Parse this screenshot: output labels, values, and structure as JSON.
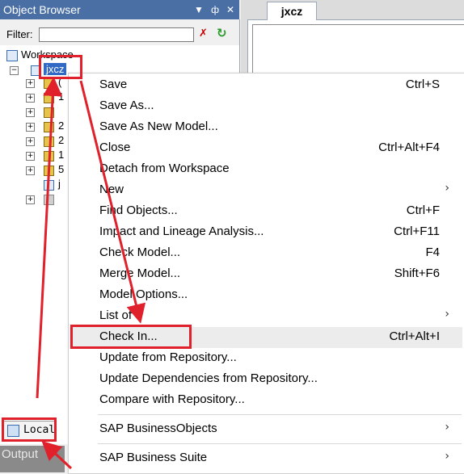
{
  "object_browser": {
    "title": "Object Browser",
    "pin_glyph": "▼",
    "dock_glyph": "ф",
    "close_glyph": "✕",
    "filter_label": "Filter:",
    "filter_value": "",
    "workspace_label": "Workspace",
    "model_label": "jxcz",
    "child_fragments": [
      "(",
      "1",
      "",
      "2",
      "2",
      "1",
      "5",
      "j",
      ""
    ],
    "local_tab_label": "Local",
    "output_label": "Output"
  },
  "document": {
    "tab_label": "jxcz"
  },
  "context_menu": {
    "items": [
      {
        "label": "Save",
        "shortcut": "Ctrl+S",
        "submenu": false
      },
      {
        "label": "Save As...",
        "shortcut": "",
        "submenu": false
      },
      {
        "label": "Save As New Model...",
        "shortcut": "",
        "submenu": false
      },
      {
        "label": "Close",
        "shortcut": "Ctrl+Alt+F4",
        "submenu": false
      },
      {
        "label": "Detach from Workspace",
        "shortcut": "",
        "submenu": false
      },
      {
        "label": "New",
        "shortcut": "",
        "submenu": true
      },
      {
        "label": "Find Objects...",
        "shortcut": "Ctrl+F",
        "submenu": false
      },
      {
        "label": "Impact and Lineage Analysis...",
        "shortcut": "Ctrl+F11",
        "submenu": false
      },
      {
        "label": "Check Model...",
        "shortcut": "F4",
        "submenu": false
      },
      {
        "label": "Merge Model...",
        "shortcut": "Shift+F6",
        "submenu": false
      },
      {
        "label": "Model Options...",
        "shortcut": "",
        "submenu": false
      },
      {
        "label": "List of",
        "shortcut": "",
        "submenu": true
      },
      {
        "label": "Check In...",
        "shortcut": "Ctrl+Alt+I",
        "submenu": false
      },
      {
        "label": "Update from Repository...",
        "shortcut": "",
        "submenu": false
      },
      {
        "label": "Update Dependencies from Repository...",
        "shortcut": "",
        "submenu": false
      },
      {
        "label": "Compare with Repository...",
        "shortcut": "",
        "submenu": false
      },
      {
        "label": "SAP BusinessObjects",
        "shortcut": "",
        "submenu": true
      },
      {
        "label": "SAP Business Suite",
        "shortcut": "",
        "submenu": true
      }
    ],
    "submenu_arrow": "›"
  },
  "colors": {
    "title_bar": "#4a6fa5",
    "selection": "#316ac5",
    "annotation": "#e0202a",
    "menu_highlight": "#ececec"
  }
}
